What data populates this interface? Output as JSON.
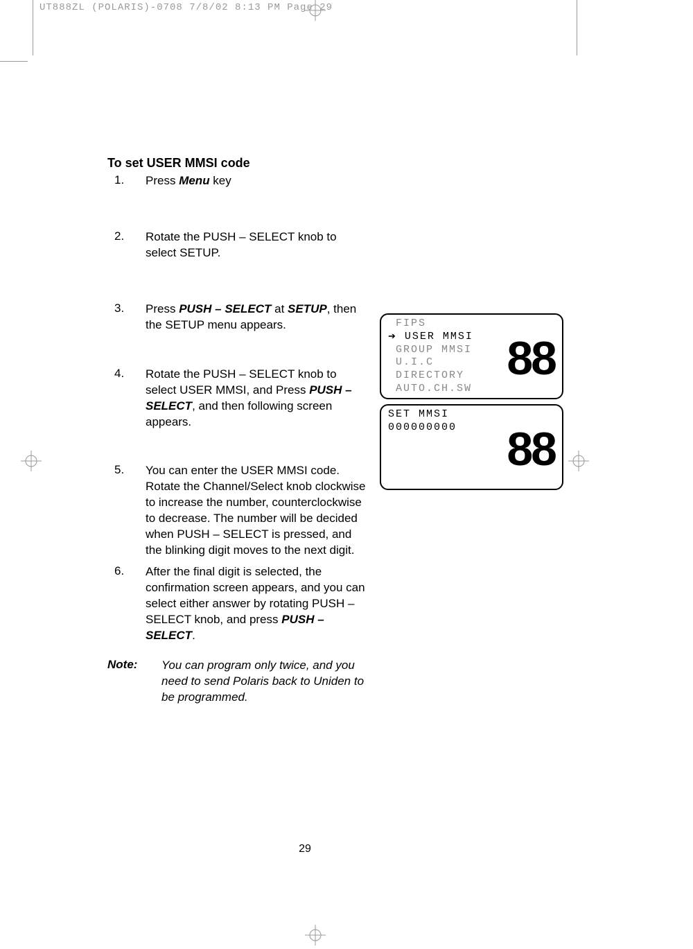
{
  "header": {
    "info": "UT888ZL  (POLARIS)-0708  7/8/02  8:13 PM  Page 29"
  },
  "heading": "To set USER MMSI code",
  "steps": {
    "s1_num": "1.",
    "s1_text_a": "Press ",
    "s1_text_b": "Menu",
    "s1_text_c": " key",
    "s2_num": "2.",
    "s2_text": "Rotate the PUSH – SELECT knob to select SETUP.",
    "s3_num": "3.",
    "s3_text_a": "Press ",
    "s3_text_b": "PUSH – SELECT",
    "s3_text_c": " at ",
    "s3_text_d": "SETUP",
    "s3_text_e": ", then the SETUP menu appears.",
    "s4_num": "4.",
    "s4_text_a": "Rotate the PUSH – SELECT knob to select USER MMSI, and Press ",
    "s4_text_b": "PUSH – SELECT",
    "s4_text_c": ", and then following screen appears.",
    "s5_num": "5.",
    "s5_text": "You can enter the USER MMSI code. Rotate the Channel/Select knob clockwise to increase the number, counterclockwise to decrease. The number will be decided when PUSH – SELECT is pressed, and the blinking digit moves to the next digit.",
    "s6_num": "6.",
    "s6_text_a": "After the final digit is selected, the confirmation screen appears, and you can select either answer by rotating PUSH – SELECT knob, and press ",
    "s6_text_b": "PUSH – SELECT",
    "s6_text_c": "."
  },
  "note": {
    "label": "Note:",
    "text": "You can program only twice, and you need to send Polaris back to Uniden to be programmed."
  },
  "lcd1": {
    "line1": " FIPS",
    "line2": " USER MMSI",
    "line3": " GROUP MMSI",
    "line4": " U.I.C",
    "line5": " DIRECTORY",
    "line6": " AUTO.CH.SW",
    "big": "88"
  },
  "lcd2": {
    "line1": "SET MMSI",
    "line2": "000000000",
    "big": "88"
  },
  "page_number": "29"
}
